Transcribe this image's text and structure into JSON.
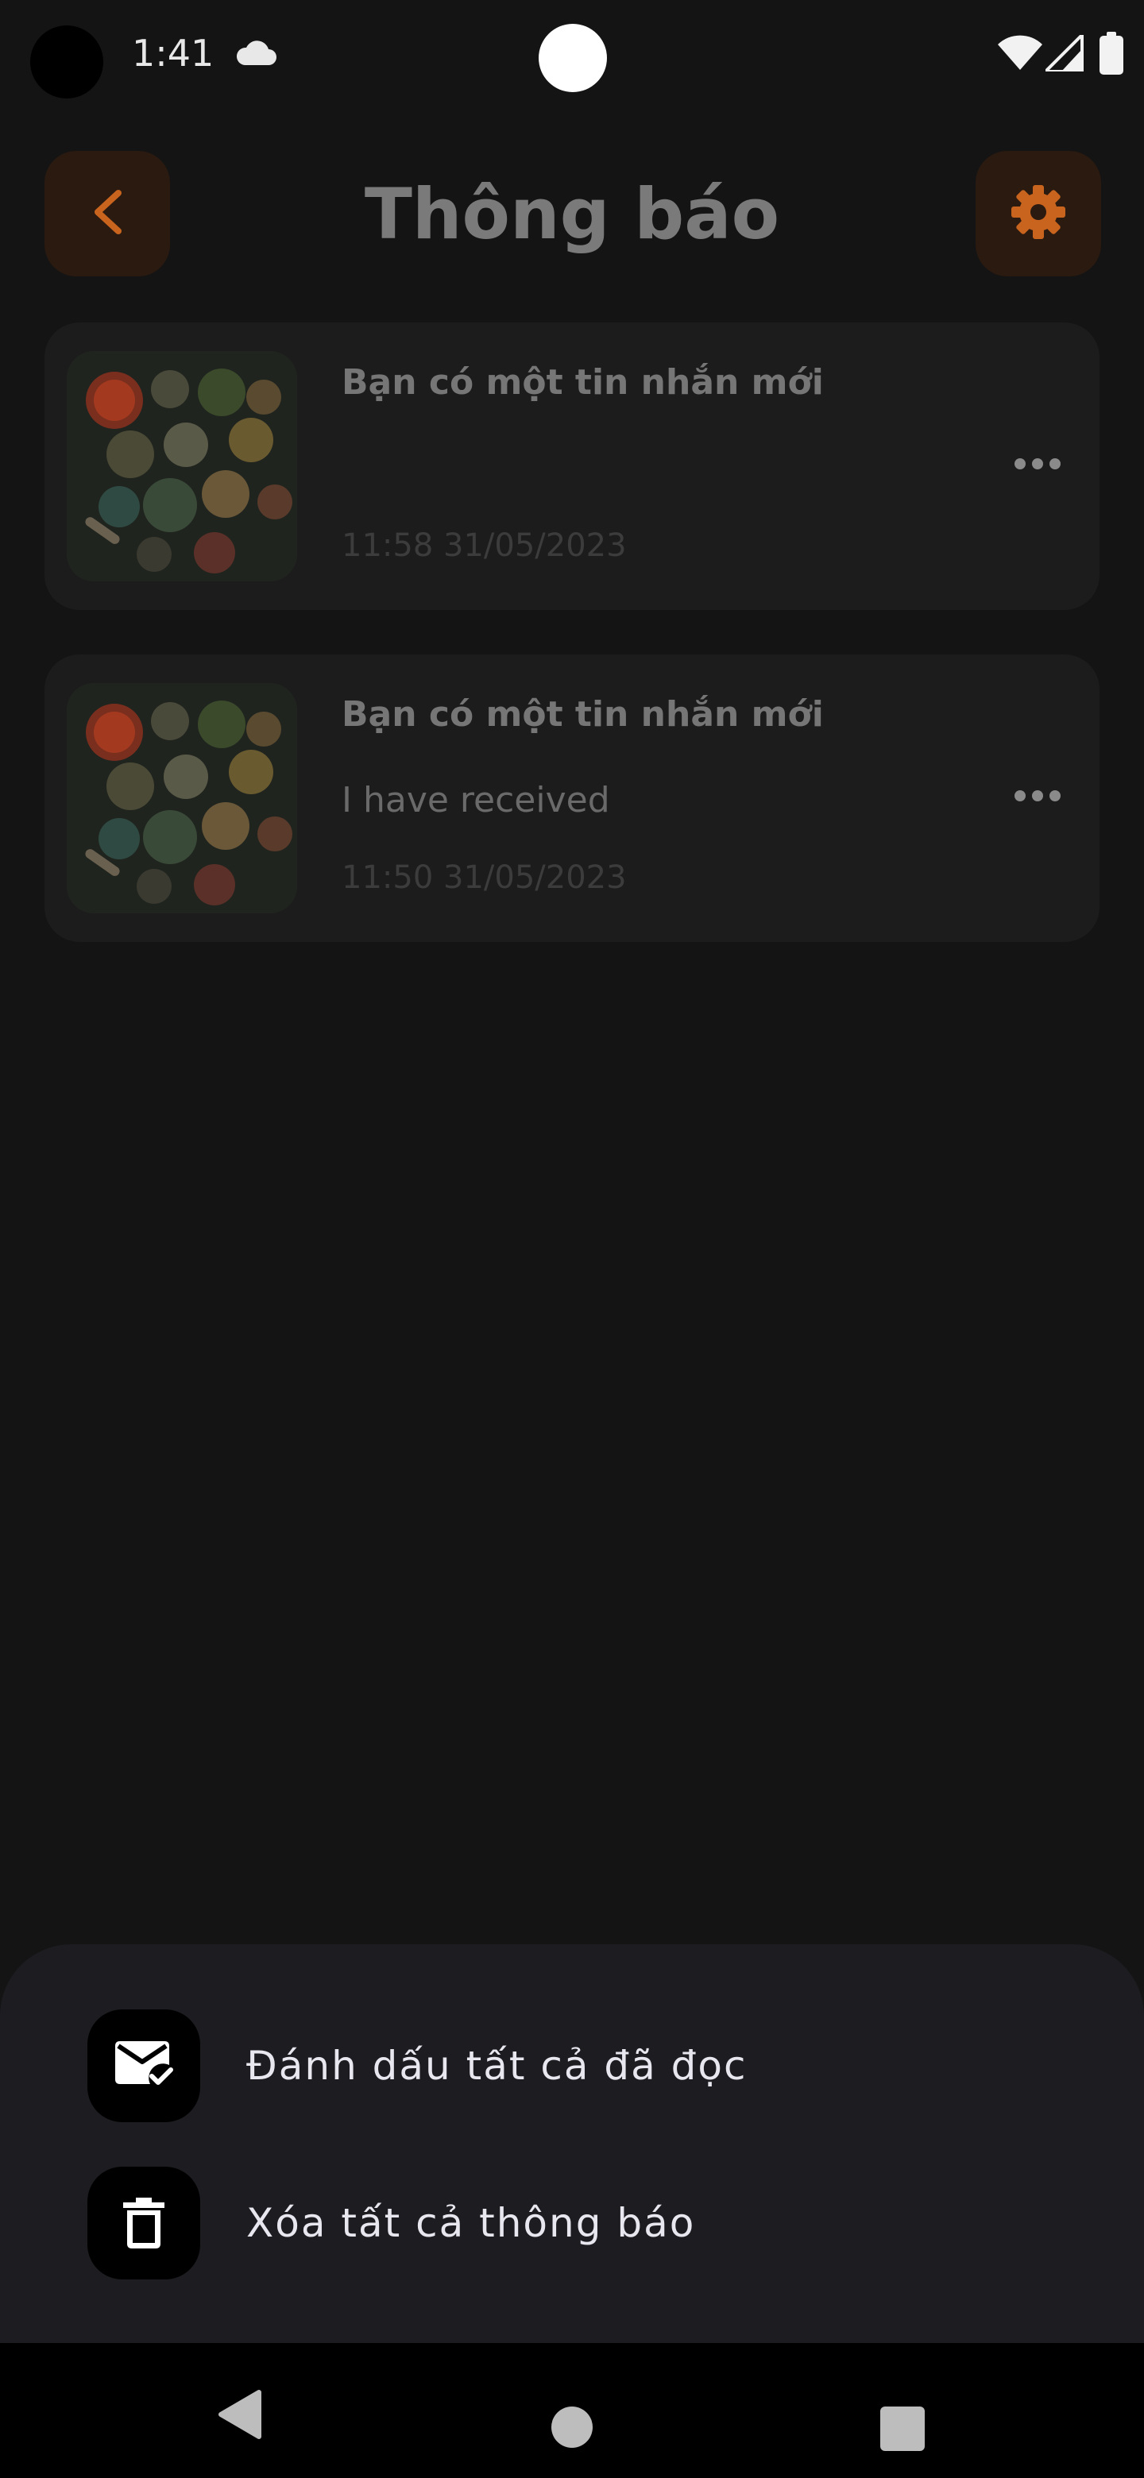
{
  "status_bar": {
    "time": "1:41",
    "icons": [
      "camera-hole",
      "cloud-icon",
      "wifi-icon",
      "signal-icon",
      "battery-icon"
    ]
  },
  "header": {
    "title": "Thông báo",
    "back_icon": "chevron-left-icon",
    "settings_icon": "gear-icon",
    "accent_color": "#c8641e"
  },
  "notifications": [
    {
      "title": "Bạn có một tin nhắn mới",
      "body": "",
      "time": "11:58 31/05/2023",
      "thumbnail": "food-dishes-image",
      "more_icon": "more-horizontal-icon"
    },
    {
      "title": "Bạn có một tin nhắn mới",
      "body": "I have received",
      "time": "11:50 31/05/2023",
      "thumbnail": "food-dishes-image",
      "more_icon": "more-horizontal-icon"
    }
  ],
  "bottom_sheet": {
    "items": [
      {
        "label": "Đánh dấu tất cả đã đọc",
        "icon": "mail-check-icon"
      },
      {
        "label": "Xóa tất cả thông báo",
        "icon": "trash-icon"
      }
    ]
  },
  "nav_bar": {
    "icons": [
      "nav-back-icon",
      "nav-home-icon",
      "nav-recents-icon"
    ]
  }
}
